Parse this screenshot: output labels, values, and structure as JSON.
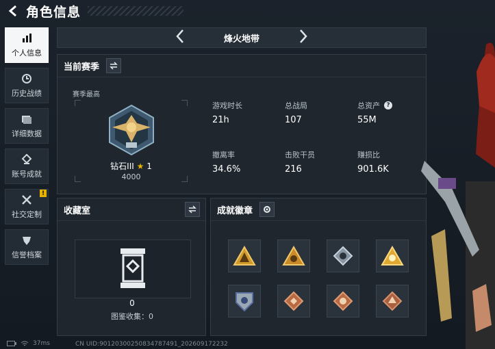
{
  "header": {
    "title": "角色信息"
  },
  "sidebar": {
    "items": [
      {
        "label": "个人信息",
        "icon": "bar-chart-icon",
        "active": true
      },
      {
        "label": "历史战绩",
        "icon": "history-clock-icon"
      },
      {
        "label": "详细数据",
        "icon": "folder-icon"
      },
      {
        "label": "账号成就",
        "icon": "achievement-icon"
      },
      {
        "label": "社交定制",
        "icon": "tools-icon",
        "badge": "!"
      },
      {
        "label": "信誉档案",
        "icon": "credit-shield-icon"
      }
    ]
  },
  "map_selector": {
    "name": "烽火地带"
  },
  "season": {
    "title": "当前赛季",
    "best_label": "赛季最高",
    "rank_name": "钻石III",
    "rank_star": "1",
    "rank_score": "4000",
    "stats": [
      {
        "label": "游戏时长",
        "value": "21h"
      },
      {
        "label": "总战局",
        "value": "107"
      },
      {
        "label": "总资产",
        "value": "55M",
        "help": "?"
      },
      {
        "label": "撤离率",
        "value": "34.6%"
      },
      {
        "label": "击败干员",
        "value": "216"
      },
      {
        "label": "赚损比",
        "value": "901.6K"
      }
    ]
  },
  "collection": {
    "title": "收藏室",
    "count": "0",
    "label": "图鉴收集：0"
  },
  "achievements": {
    "title": "成就徽章",
    "badges": [
      "badge-1",
      "badge-2",
      "badge-3",
      "badge-4",
      "badge-5",
      "badge-6",
      "badge-7",
      "badge-8"
    ]
  },
  "status": {
    "ping": "37ms",
    "uid": "CN UID:901203002508347874​91_202609172232"
  },
  "colors": {
    "accent_gold": "#e6b400",
    "panel": "#1f262e",
    "active_tab": "#f4f6f7"
  }
}
